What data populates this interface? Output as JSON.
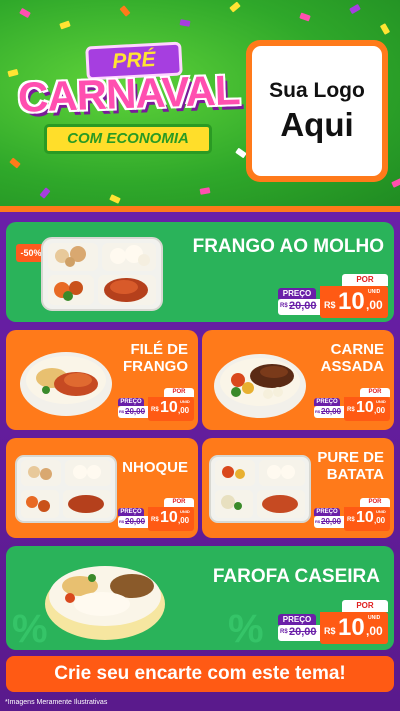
{
  "header": {
    "pre_label": "PRÉ",
    "carnaval_label": "CARNAVAL",
    "economia_label": "COM ECONOMIA",
    "logo_line1": "Sua Logo",
    "logo_line2": "Aqui"
  },
  "products": [
    {
      "title_line1": "FRANGO AO MOLHO",
      "title_line2": "",
      "badge": "-50%",
      "preco_label": "PREÇO",
      "por_label": "POR",
      "old_currency": "R$",
      "old_price": "20,00",
      "new_currency": "R$",
      "new_price_int": "10",
      "new_price_dec": ",00",
      "unit": "UNID"
    },
    {
      "title_line1": "FILÉ DE",
      "title_line2": "FRANGO",
      "preco_label": "PREÇO",
      "por_label": "POR",
      "old_currency": "R$",
      "old_price": "20,00",
      "new_currency": "R$",
      "new_price_int": "10",
      "new_price_dec": ",00",
      "unit": "UNID"
    },
    {
      "title_line1": "CARNE",
      "title_line2": "ASSADA",
      "preco_label": "PREÇO",
      "por_label": "POR",
      "old_currency": "R$",
      "old_price": "20,00",
      "new_currency": "R$",
      "new_price_int": "10",
      "new_price_dec": ",00",
      "unit": "UNID"
    },
    {
      "title_line1": "NHOQUE",
      "title_line2": "",
      "preco_label": "PREÇO",
      "por_label": "POR",
      "old_currency": "R$",
      "old_price": "20,00",
      "new_currency": "R$",
      "new_price_int": "10",
      "new_price_dec": ",00",
      "unit": "UNID"
    },
    {
      "title_line1": "PURE DE",
      "title_line2": "BATATA",
      "preco_label": "PREÇO",
      "por_label": "POR",
      "old_currency": "R$",
      "old_price": "20,00",
      "new_currency": "R$",
      "new_price_int": "10",
      "new_price_dec": ",00",
      "unit": "UNID"
    },
    {
      "title_line1": "FAROFA CASEIRA",
      "title_line2": "",
      "preco_label": "PREÇO",
      "por_label": "POR",
      "old_currency": "R$",
      "old_price": "20,00",
      "new_currency": "R$",
      "new_price_int": "10",
      "new_price_dec": ",00",
      "unit": "UNID"
    }
  ],
  "cta_label": "Crie seu encarte com este tema!",
  "footnote": "*Imagens Meramente Ilustrativas",
  "colors": {
    "green_card": "#2ab35a",
    "orange_card": "#ff7a1a",
    "purple_bg": "#5a1a8c",
    "price_orange": "#ff5a14",
    "preco_purple": "#6a1fa8"
  }
}
